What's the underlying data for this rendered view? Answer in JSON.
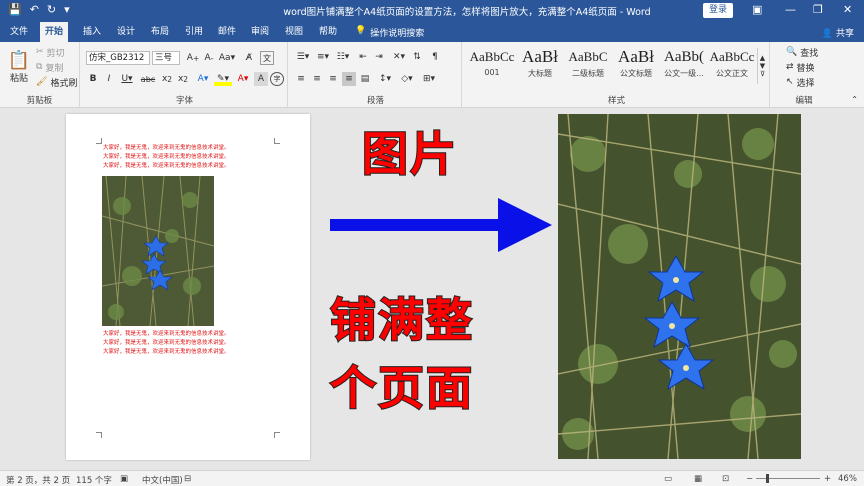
{
  "titlebar": {
    "title": "word图片铺满整个A4纸页面的设置方法，怎样将图片放大，充满整个A4纸页面 - Word",
    "login_label": "登录"
  },
  "tabs": [
    "文件",
    "开始",
    "插入",
    "设计",
    "布局",
    "引用",
    "邮件",
    "审阅",
    "视图",
    "帮助"
  ],
  "tellme": "操作说明搜索",
  "share": "共享",
  "clipboard": {
    "paste": "粘贴",
    "cut": "剪切",
    "copy": "复制",
    "format_painter": "格式刷",
    "group": "剪贴板"
  },
  "font": {
    "name": "仿宋_GB2312",
    "size": "三号",
    "group": "字体"
  },
  "paragraph": {
    "group": "段落"
  },
  "styles": {
    "group": "样式",
    "items": [
      {
        "preview": "AaBbCc",
        "name": "001"
      },
      {
        "preview": "AaBł",
        "name": "大标题"
      },
      {
        "preview": "AaBbC",
        "name": "二级标题"
      },
      {
        "preview": "AaBł",
        "name": "公文标题"
      },
      {
        "preview": "AaBb(",
        "name": "公文一级..."
      },
      {
        "preview": "AaBbCc",
        "name": "公文正文"
      }
    ]
  },
  "editing": {
    "find": "查找",
    "replace": "替换",
    "select": "选择",
    "group": "编辑"
  },
  "page": {
    "top_lines": [
      "大家好，我是无鬼，欢迎来到无鬼的信息技术讲堂。",
      "大家好，我是无鬼，欢迎来到无鬼的信息技术讲堂。",
      "大家好，我是无鬼，欢迎来到无鬼的信息技术讲堂。"
    ],
    "bottom_lines": [
      "大家好，我是无鬼，欢迎来到无鬼的信息技术讲堂。",
      "大家好，我是无鬼，欢迎来到无鬼的信息技术讲堂。",
      "大家好，我是无鬼，欢迎来到无鬼的信息技术讲堂。"
    ]
  },
  "overlay": {
    "word_picture": "图片",
    "line1": "铺满整",
    "line2": "个页面",
    "arrow_color": "#0a10e8",
    "text_color": "#ff0000"
  },
  "statusbar": {
    "page": "第 2 页，共 2 页",
    "words": "115 个字",
    "lang": "中文(中国)",
    "zoom": "46%"
  }
}
